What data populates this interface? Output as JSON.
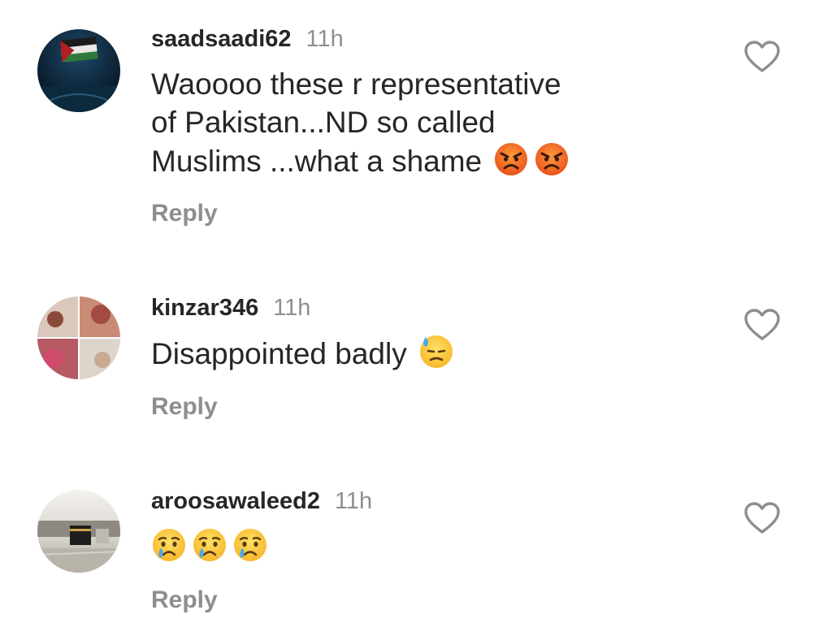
{
  "comments": [
    {
      "username": "saadsaadi62",
      "time": "11h",
      "text_lines": [
        "Waoooo these r representative",
        "of Pakistan...ND so called",
        "Muslims ...what a shame"
      ],
      "emojis": [
        "angry-face-emoji",
        "angry-face-emoji"
      ],
      "reply_label": "Reply",
      "avatar": "dark-blue-flag-avatar"
    },
    {
      "username": "kinzar346",
      "time": "11h",
      "text_lines": [
        "Disappointed badly"
      ],
      "emojis": [
        "downcast-face-with-sweat-emoji"
      ],
      "reply_label": "Reply",
      "avatar": "photo-collage-avatar"
    },
    {
      "username": "aroosawaleed2",
      "time": "11h",
      "text_lines": [],
      "emojis": [
        "crying-face-emoji",
        "crying-face-emoji",
        "crying-face-emoji"
      ],
      "reply_label": "Reply",
      "avatar": "kaaba-avatar"
    }
  ],
  "colors": {
    "text": "#262626",
    "secondary": "#8e8e8e",
    "heart_outline": "#8e8e8e",
    "emoji_angry": "#f26b1d",
    "emoji_yellow": "#ffcc33",
    "tear": "#4aa8e8"
  }
}
